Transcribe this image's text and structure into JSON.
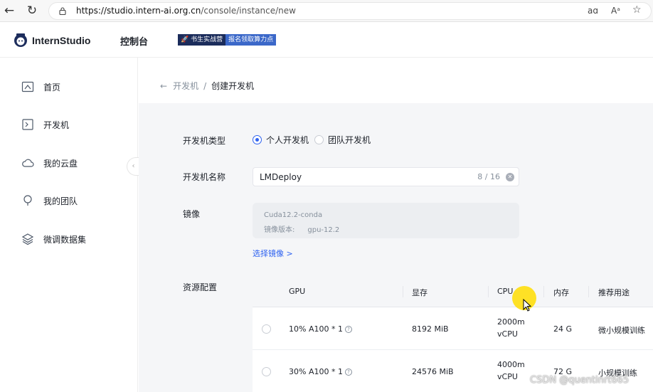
{
  "browser": {
    "url_host": "https://studio.intern-ai.org.cn",
    "url_path": "/console/instance/new",
    "read_aloud_icon": "aɑ",
    "text_size_icon": "Aᵃ"
  },
  "header": {
    "brand": "InternStudio",
    "console": "控制台",
    "promo_left": "🚀 书生实战营",
    "promo_right": "报名领取算力点"
  },
  "sidebar": {
    "items": [
      {
        "label": "首页",
        "icon": "home-icon"
      },
      {
        "label": "开发机",
        "icon": "terminal-icon"
      },
      {
        "label": "我的云盘",
        "icon": "cloud-icon"
      },
      {
        "label": "我的团队",
        "icon": "team-icon"
      },
      {
        "label": "微调数据集",
        "icon": "layers-icon"
      }
    ]
  },
  "breadcrumb": {
    "parent": "开发机",
    "separator": "/",
    "current": "创建开发机"
  },
  "form": {
    "type_label": "开发机类型",
    "type_options": [
      "个人开发机",
      "团队开发机"
    ],
    "type_selected": "个人开发机",
    "name_label": "开发机名称",
    "name_value": "LMDeploy",
    "name_counter": "8 / 16",
    "image_label": "镜像",
    "image_name": "Cuda12.2-conda",
    "image_version_label": "镜像版本:",
    "image_version": "gpu-12.2",
    "select_image": "选择镜像 >",
    "resource_label": "资源配置"
  },
  "resource_table": {
    "headers": [
      "GPU",
      "显存",
      "CPU",
      "内存",
      "推荐用途"
    ],
    "rows": [
      {
        "gpu": "10% A100 * 1",
        "vram": "8192 MiB",
        "cpu1": "2000m",
        "cpu2": "vCPU",
        "mem": "24 G",
        "use": "微小规模训练"
      },
      {
        "gpu": "30% A100 * 1",
        "vram": "24576 MiB",
        "cpu1": "4000m",
        "cpu2": "vCPU",
        "mem": "72 G",
        "use": "小规模训练"
      }
    ]
  },
  "watermark": "CSDN @quentinrt665",
  "colors": {
    "accent": "#2f63f0",
    "promo_dark": "#1b2c5b",
    "promo_blue": "#3b68c9"
  }
}
